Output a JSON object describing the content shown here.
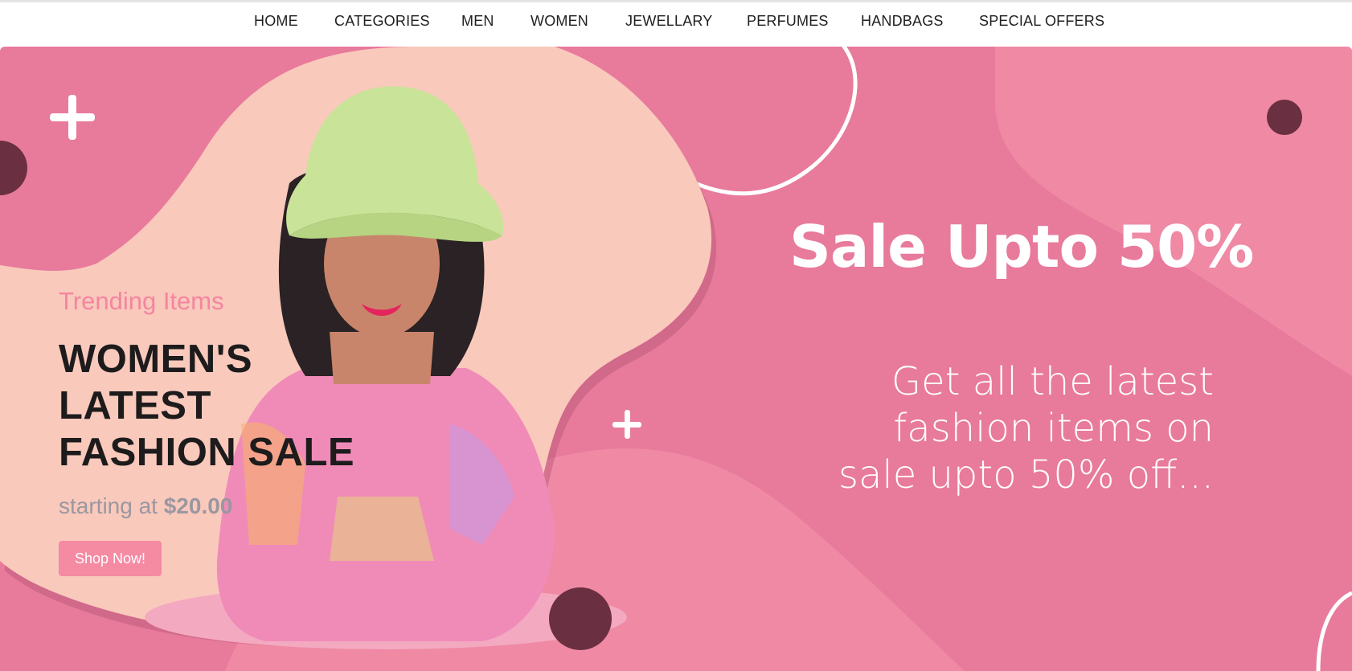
{
  "nav": {
    "items": [
      {
        "label": "HOME"
      },
      {
        "label": "CATEGORIES"
      },
      {
        "label": "MEN"
      },
      {
        "label": "WOMEN"
      },
      {
        "label": "JEWELLARY"
      },
      {
        "label": "PERFUMES"
      },
      {
        "label": "HANDBAGS"
      },
      {
        "label": "SPECIAL OFFERS"
      }
    ]
  },
  "hero": {
    "trending": "Trending Items",
    "headline_line1": "WOMEN'S",
    "headline_line2": "LATEST",
    "headline_line3": "FASHION SALE",
    "price_prefix": "starting at",
    "price_value": "$20.00",
    "cta_label": "Shop Now!",
    "sale_title": "Sale Upto 50%",
    "sale_sub_line1": "Get all the latest",
    "sale_sub_line2": "fashion items on",
    "sale_sub_line3": "sale upto 50% off..."
  },
  "colors": {
    "hero_bg": "#e87a9b",
    "hero_bg_light": "#f08aa3",
    "blob_peach": "#f9c9bc",
    "dark_dot": "#6a2f40",
    "cta_bg": "#f58aa3",
    "trending_text": "#f585a0"
  },
  "icons": {
    "plus_left": "plus-icon",
    "plus_center": "plus-icon"
  }
}
